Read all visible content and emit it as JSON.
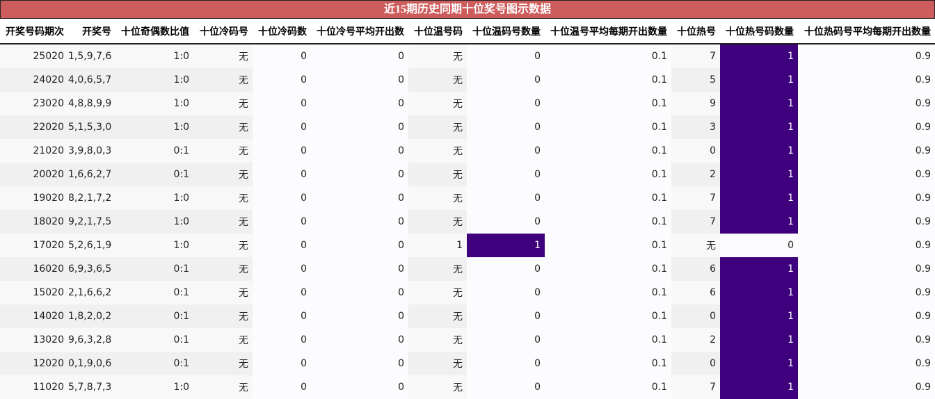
{
  "title": "近15期历史同期十位奖号图示数据",
  "columns": [
    "开奖号码期次",
    "开奖号",
    "十位奇偶数比值",
    "十位冷码号",
    "十位冷码数",
    "十位冷号平均开出数",
    "十位温号码",
    "十位温码号数量",
    "十位温号平均每期开出数量",
    "十位热号",
    "十位热号码数量",
    "十位热码号平均每期开出数量"
  ],
  "colors": {
    "title_bg": "#cd5c5c",
    "highlight": "#3f007d"
  },
  "rows": [
    [
      "25020",
      "1,5,9,7,6",
      "1:0",
      "无",
      "0",
      "0",
      "无",
      "0",
      "0.1",
      "7",
      "1",
      "0.9"
    ],
    [
      "24020",
      "4,0,6,5,7",
      "1:0",
      "无",
      "0",
      "0",
      "无",
      "0",
      "0.1",
      "5",
      "1",
      "0.9"
    ],
    [
      "23020",
      "4,8,8,9,9",
      "1:0",
      "无",
      "0",
      "0",
      "无",
      "0",
      "0.1",
      "9",
      "1",
      "0.9"
    ],
    [
      "22020",
      "5,1,5,3,0",
      "1:0",
      "无",
      "0",
      "0",
      "无",
      "0",
      "0.1",
      "3",
      "1",
      "0.9"
    ],
    [
      "21020",
      "3,9,8,0,3",
      "0:1",
      "无",
      "0",
      "0",
      "无",
      "0",
      "0.1",
      "0",
      "1",
      "0.9"
    ],
    [
      "20020",
      "1,6,6,2,7",
      "0:1",
      "无",
      "0",
      "0",
      "无",
      "0",
      "0.1",
      "2",
      "1",
      "0.9"
    ],
    [
      "19020",
      "8,2,1,7,2",
      "1:0",
      "无",
      "0",
      "0",
      "无",
      "0",
      "0.1",
      "7",
      "1",
      "0.9"
    ],
    [
      "18020",
      "9,2,1,7,5",
      "1:0",
      "无",
      "0",
      "0",
      "无",
      "0",
      "0.1",
      "7",
      "1",
      "0.9"
    ],
    [
      "17020",
      "5,2,6,1,9",
      "1:0",
      "无",
      "0",
      "0",
      "1",
      "1",
      "0.1",
      "无",
      "0",
      "0.9"
    ],
    [
      "16020",
      "6,9,3,6,5",
      "0:1",
      "无",
      "0",
      "0",
      "无",
      "0",
      "0.1",
      "6",
      "1",
      "0.9"
    ],
    [
      "15020",
      "2,1,6,6,2",
      "0:1",
      "无",
      "0",
      "0",
      "无",
      "0",
      "0.1",
      "6",
      "1",
      "0.9"
    ],
    [
      "14020",
      "1,8,2,0,2",
      "0:1",
      "无",
      "0",
      "0",
      "无",
      "0",
      "0.1",
      "0",
      "1",
      "0.9"
    ],
    [
      "13020",
      "9,6,3,2,8",
      "0:1",
      "无",
      "0",
      "0",
      "无",
      "0",
      "0.1",
      "2",
      "1",
      "0.9"
    ],
    [
      "12020",
      "0,1,9,0,6",
      "0:1",
      "无",
      "0",
      "0",
      "无",
      "0",
      "0.1",
      "0",
      "1",
      "0.9"
    ],
    [
      "11020",
      "5,7,8,7,3",
      "1:0",
      "无",
      "0",
      "0",
      "无",
      "0",
      "0.1",
      "7",
      "1",
      "0.9"
    ]
  ]
}
